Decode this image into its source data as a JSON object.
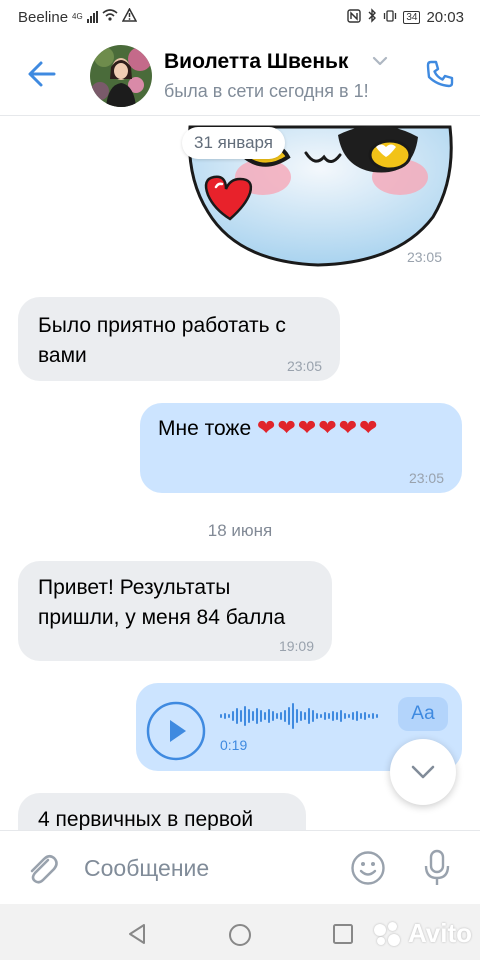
{
  "status_bar": {
    "carrier": "Beeline",
    "network": "4G",
    "battery": "34",
    "time": "20:03"
  },
  "header": {
    "contact_name": "Виолетта Швеньк",
    "contact_status": "была в сети сегодня в 1!"
  },
  "messages": {
    "sticker_date": "31 января",
    "sticker_time": "23:05",
    "msg1_text": "Было приятно работать с вами",
    "msg1_time": "23:05",
    "msg2_text": "Мне тоже",
    "msg2_time": "23:05",
    "date_divider": "18 июня",
    "msg3_text": "Привет! Результаты пришли, у меня 84 балла",
    "msg3_time": "19:09",
    "voice_duration": "0:19",
    "voice_transcribe": "Аа",
    "msg4_text": "4 первичных в первой"
  },
  "composer": {
    "placeholder": "Сообщение"
  },
  "watermark": {
    "text": "Avito"
  },
  "colors": {
    "accent": "#3f8ae0",
    "incoming_bubble": "#ebedf0",
    "outgoing_bubble": "#cce4ff",
    "heart": "#e0242b"
  }
}
